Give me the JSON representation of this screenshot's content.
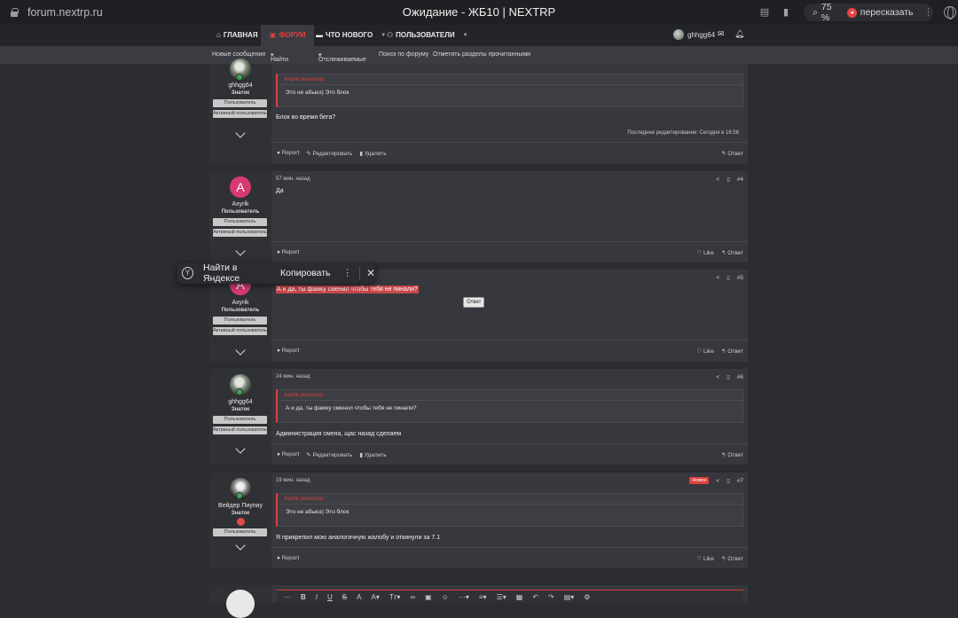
{
  "browser": {
    "url": "forum.nextrp.ru",
    "title": "Ожидание - ЖБ10 | NEXTRP",
    "zoom": "75 %",
    "translate_label": "пересказать"
  },
  "nav": {
    "home": "ГЛАВНАЯ",
    "forums": "ФОРУМ",
    "whats_new": "ЧТО НОВОГО",
    "users": "ПОЛЬЗОВАТЕЛИ",
    "account": "ghhgg64"
  },
  "subnav": {
    "items": [
      "Новые сообщения",
      "Найти темы",
      "Отслеживаемые",
      "Поиск по форуму",
      "Отметить разделы прочитанными"
    ]
  },
  "common": {
    "report": "Report",
    "edit": "Редактировать",
    "delete": "Удалить",
    "like": "Like",
    "reply": "Ответ",
    "badge_user": "Пользователь",
    "badge_active": "Активный пользователь"
  },
  "posts": [
    {
      "username": "ghhgg64",
      "usertitle": "Знаток",
      "quote_author": "Axyrik сказал(а):",
      "quote_text": "Это не абьюз) Это блок",
      "message": "Блок во время бега?",
      "edited": "Последнее редактирование: Сегодня в 16:56"
    },
    {
      "username": "Axyrik",
      "avatar_letter": "A",
      "usertitle": "Пользователь",
      "time": "57 мин. назад",
      "number": "#4",
      "message": "Да"
    },
    {
      "username": "Axyrik",
      "avatar_letter": "A",
      "usertitle": "Пользователь",
      "number": "#5",
      "message": "А и да, ты фамку сменил чтобы тебя не пинали?",
      "tooltip": "Ответ"
    },
    {
      "username": "ghhgg64",
      "usertitle": "Знаток",
      "time": "24 мин. назад",
      "number": "#6",
      "quote_author": "Axyrik сказал(а):",
      "quote_text": "А и да, ты фамку сменил чтобы тебя не пинали?",
      "message": "Администрация смена, щас назад сделаем"
    },
    {
      "username": "Вейдер Пиупиу",
      "usertitle": "Знаток",
      "time": "19 мин. назад",
      "number": "#7",
      "new_label": "Новое",
      "quote_author": "Axyrik сказал(а):",
      "quote_text": "Это не абьюз) Это блок",
      "message": "Я прикрепил мою аналогичную жалобу и откинули за 7.1"
    }
  ],
  "popup": {
    "search": "Найти в Яндексе",
    "copy": "Копировать"
  }
}
